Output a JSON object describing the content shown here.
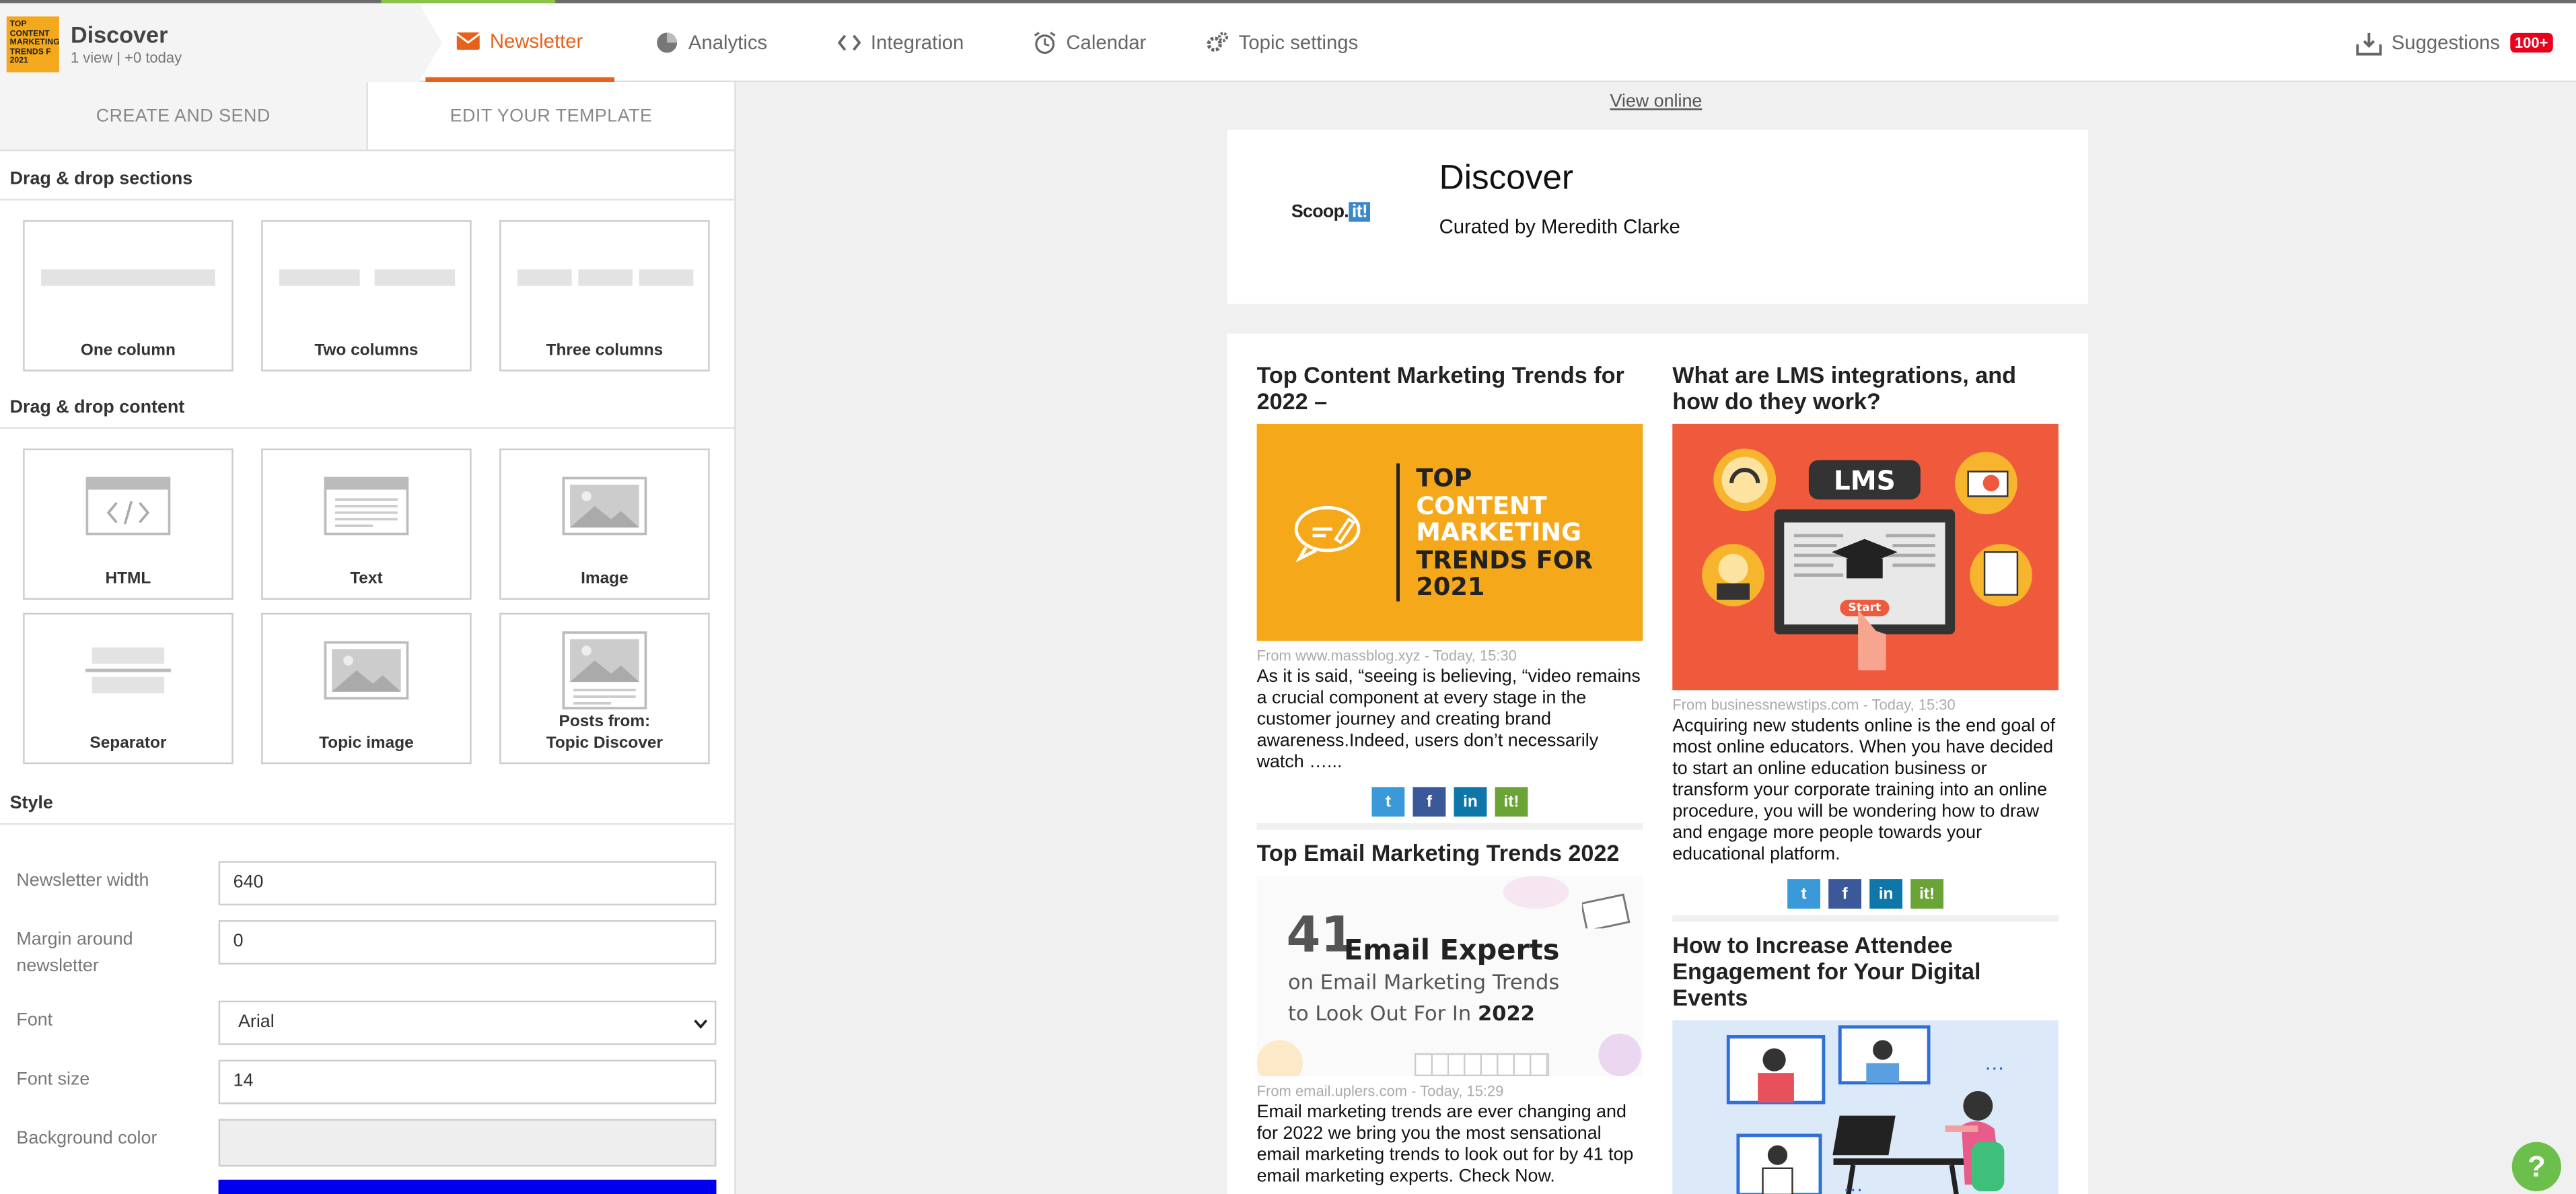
{
  "brand": {
    "title": "Discover",
    "subtitle": "1 view | +0 today",
    "thumb_text": "TOP CONTENT MARKETING TRENDS F 2021"
  },
  "nav": {
    "newsletter": "Newsletter",
    "analytics": "Analytics",
    "integration": "Integration",
    "calendar": "Calendar",
    "topic_settings": "Topic settings",
    "suggestions": "Suggestions",
    "suggestions_badge": "100+"
  },
  "panel": {
    "tabs": [
      "CREATE AND SEND",
      "EDIT YOUR TEMPLATE"
    ],
    "sections_heading": "Drag & drop sections",
    "sections": [
      "One column",
      "Two columns",
      "Three columns"
    ],
    "content_heading": "Drag & drop content",
    "content": [
      "HTML",
      "Text",
      "Image",
      "Separator",
      "Topic image",
      "Posts from:",
      "Topic Discover"
    ],
    "style_heading": "Style",
    "style": {
      "width_label": "Newsletter width",
      "width_value": "640",
      "margin_label": "Margin around newsletter",
      "margin_value": "0",
      "font_label": "Font",
      "font_value": "Arial",
      "font_size_label": "Font size",
      "font_size_value": "14",
      "bg_label": "Background color",
      "bg_value": "#eeeeee",
      "link_color_value": "#0000ee"
    }
  },
  "preview": {
    "view_online": "View online",
    "logo_text": "Scoop.",
    "logo_it": "it!",
    "title": "Discover",
    "curated": "Curated by Meredith Clarke",
    "articles": [
      {
        "title": "Top Content Marketing Trends for 2022 –",
        "image_text": [
          "TOP",
          "CONTENT",
          "MARKETING",
          "TRENDS FOR",
          "2021"
        ],
        "source": "From www.massblog.xyz - Today, 15:30",
        "body": "As it is said, “seeing is believing, “video remains a crucial component at every stage in the customer journey and creating brand awareness.Indeed, users don’t necessarily watch …..."
      },
      {
        "title": "Top Email Marketing Trends 2022",
        "image_text": {
          "number": "41",
          "line1": "Email Experts",
          "line2": "on Email Marketing Trends",
          "line3": "to Look Out For In",
          "year": "2022"
        },
        "source": "From email.uplers.com - Today, 15:29",
        "body": "Email marketing trends are ever changing and for 2022 we bring you the most sensational email marketing trends to look out for by 41 top email marketing experts. Check Now."
      },
      {
        "title": "What are LMS integrations, and how do they work?",
        "image_text": {
          "lms": "LMS",
          "start": "Start"
        },
        "source": "From businessnewstips.com - Today, 15:30",
        "body": "Acquiring new students online is the end goal of most online educators. When you have decided to start an online education business or transform your corporate training into an online procedure, you will be wondering how to draw and engage more people towards your educational platform."
      },
      {
        "title": "How to Increase Attendee Engagement for Your Digital Events"
      }
    ],
    "share_colors": {
      "twitter": "#3a9ad9",
      "facebook": "#3b5998",
      "linkedin": "#0e76a8",
      "scoopit": "#6aa336"
    }
  },
  "help": "?"
}
